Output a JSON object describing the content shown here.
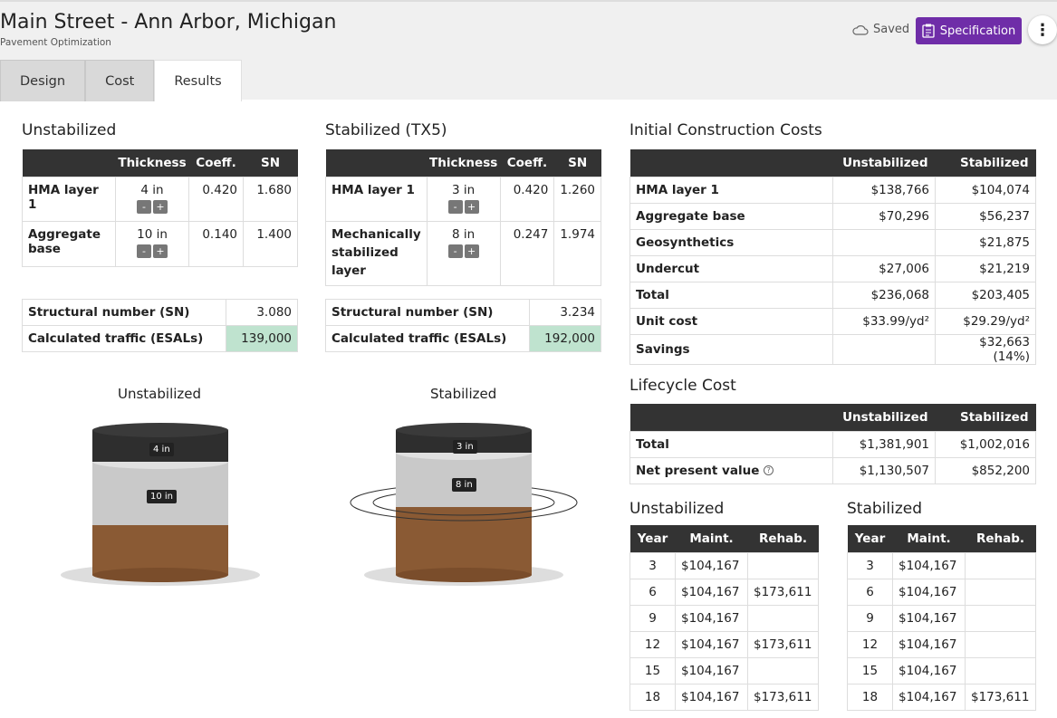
{
  "header": {
    "title": "Main Street - Ann Arbor, Michigan",
    "subtitle": "Pavement Optimization",
    "saved_label": "Saved",
    "spec_label": "Specification",
    "accent": "#6f2da8"
  },
  "tabs": [
    {
      "label": "Design"
    },
    {
      "label": "Cost"
    },
    {
      "label": "Results"
    }
  ],
  "unstab": {
    "title": "Unstabilized",
    "cols": [
      "Thickness",
      "Coeff.",
      "SN"
    ],
    "rows": [
      {
        "name": "HMA layer 1",
        "thickness": "4 in",
        "coeff": "0.420",
        "sn": "1.680"
      },
      {
        "name": "Aggregate base",
        "thickness": "10 in",
        "coeff": "0.140",
        "sn": "1.400"
      }
    ],
    "sn_label": "Structural number (SN)",
    "sn_value": "3.080",
    "traffic_label": "Calculated traffic (ESALs)",
    "traffic_value": "139,000",
    "illus_title": "Unstabilized",
    "badges": [
      "4 in",
      "10 in"
    ]
  },
  "stab": {
    "title": "Stabilized  (TX5)",
    "cols": [
      "Thickness",
      "Coeff.",
      "SN"
    ],
    "rows": [
      {
        "name": "HMA layer 1",
        "thickness": "3 in",
        "coeff": "0.420",
        "sn": "1.260"
      },
      {
        "name": "Mechanically stabilized layer",
        "thickness": "8 in",
        "coeff": "0.247",
        "sn": "1.974"
      }
    ],
    "sn_label": "Structural number (SN)",
    "sn_value": "3.234",
    "traffic_label": "Calculated traffic (ESALs)",
    "traffic_value": "192,000",
    "illus_title": "Stabilized",
    "badges": [
      "3 in",
      "8 in"
    ]
  },
  "stepper": {
    "minus": "-",
    "plus": "+"
  },
  "initial": {
    "title": "Initial Construction Costs",
    "cols": [
      "Unstabilized",
      "Stabilized"
    ],
    "rows": [
      {
        "label": "HMA layer 1",
        "u": "$138,766",
        "s": "$104,074"
      },
      {
        "label": "Aggregate base",
        "u": "$70,296",
        "s": "$56,237"
      },
      {
        "label": "Geosynthetics",
        "u": "",
        "s": "$21,875"
      },
      {
        "label": "Undercut",
        "u": "$27,006",
        "s": "$21,219"
      },
      {
        "label": "Total",
        "u": "$236,068",
        "s": "$203,405"
      },
      {
        "label": "Unit cost",
        "u": "$33.99/yd²",
        "s": "$29.29/yd²"
      },
      {
        "label": "Savings",
        "u": "",
        "s": "$32,663 (14%)"
      }
    ]
  },
  "lifecycle": {
    "title": "Lifecycle Cost",
    "cols": [
      "Unstabilized",
      "Stabilized"
    ],
    "rows": [
      {
        "label": "Total",
        "u": "$1,381,901",
        "s": "$1,002,016"
      },
      {
        "label": "Net present value",
        "u": "$1,130,507",
        "s": "$852,200"
      }
    ]
  },
  "sched_unstab": {
    "title": "Unstabilized",
    "cols": [
      "Year",
      "Maint.",
      "Rehab."
    ],
    "rows": [
      {
        "year": "3",
        "maint": "$104,167",
        "rehab": ""
      },
      {
        "year": "6",
        "maint": "$104,167",
        "rehab": "$173,611"
      },
      {
        "year": "9",
        "maint": "$104,167",
        "rehab": ""
      },
      {
        "year": "12",
        "maint": "$104,167",
        "rehab": "$173,611"
      },
      {
        "year": "15",
        "maint": "$104,167",
        "rehab": ""
      },
      {
        "year": "18",
        "maint": "$104,167",
        "rehab": "$173,611"
      }
    ]
  },
  "sched_stab": {
    "title": "Stabilized",
    "cols": [
      "Year",
      "Maint.",
      "Rehab."
    ],
    "rows": [
      {
        "year": "3",
        "maint": "$104,167",
        "rehab": ""
      },
      {
        "year": "6",
        "maint": "$104,167",
        "rehab": ""
      },
      {
        "year": "9",
        "maint": "$104,167",
        "rehab": ""
      },
      {
        "year": "12",
        "maint": "$104,167",
        "rehab": ""
      },
      {
        "year": "15",
        "maint": "$104,167",
        "rehab": ""
      },
      {
        "year": "18",
        "maint": "$104,167",
        "rehab": "$173,611"
      }
    ]
  }
}
